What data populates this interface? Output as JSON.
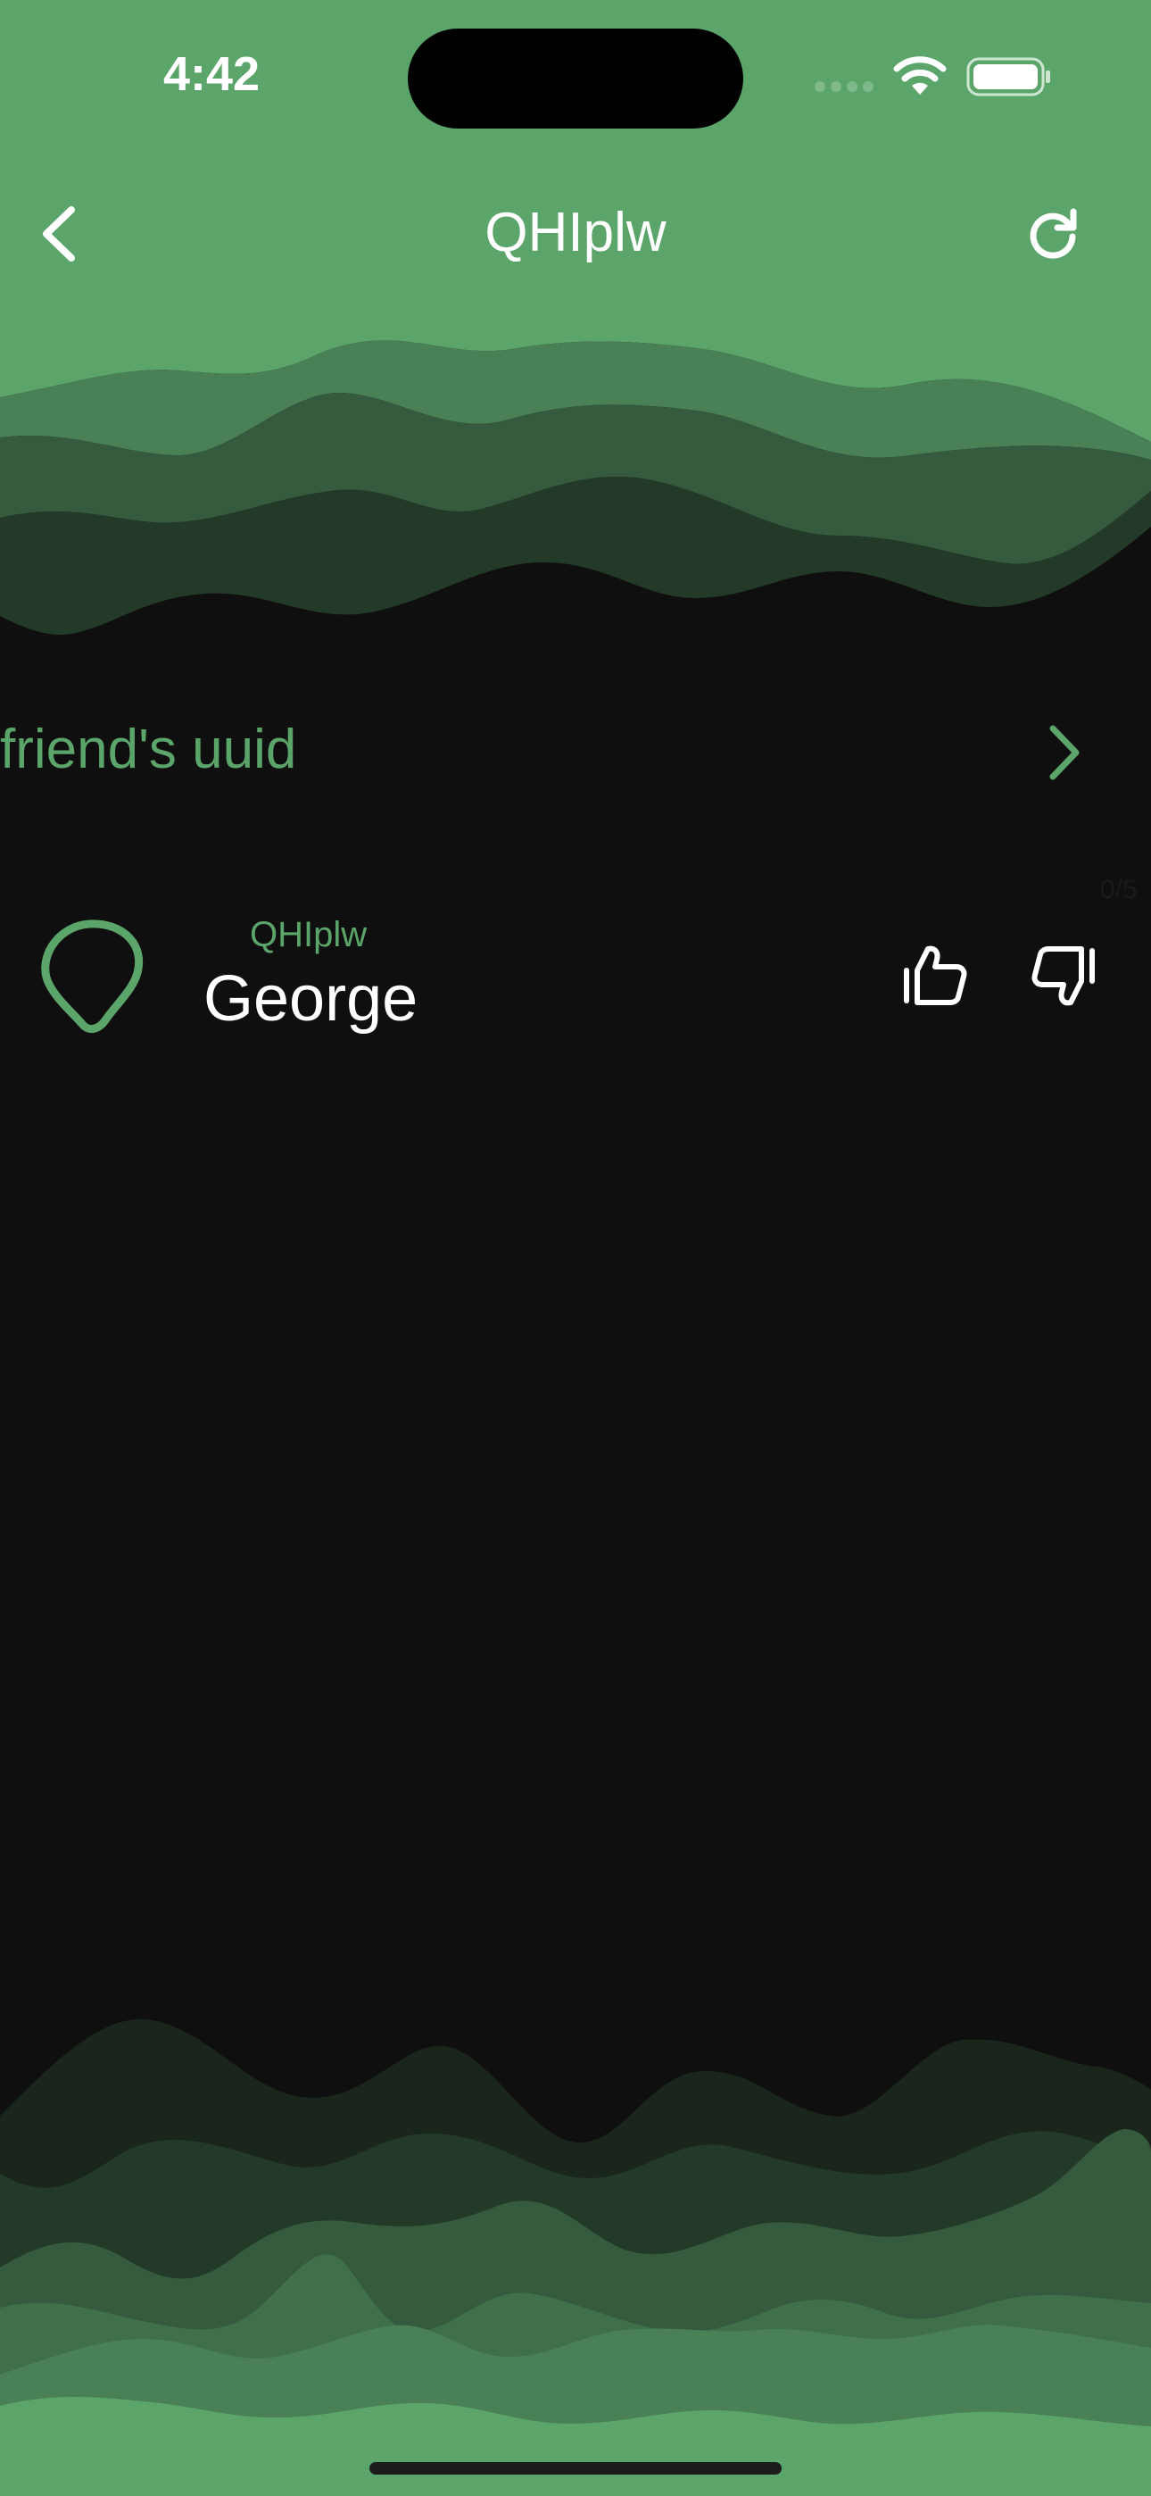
{
  "status_bar": {
    "time": "4:42"
  },
  "header": {
    "title": "QHIplw"
  },
  "friend_section": {
    "label": "friend's uuid"
  },
  "counter": "0/5",
  "item": {
    "subtitle": "QHIplw",
    "name": "George"
  },
  "colors": {
    "accent": "#5ba56a",
    "background": "#0f0f0f"
  },
  "icons": [
    "chevron-left-icon",
    "refresh-icon",
    "chevron-right-icon",
    "blob-avatar-icon",
    "thumbs-up-icon",
    "thumbs-down-icon",
    "wifi-icon",
    "battery-icon"
  ]
}
